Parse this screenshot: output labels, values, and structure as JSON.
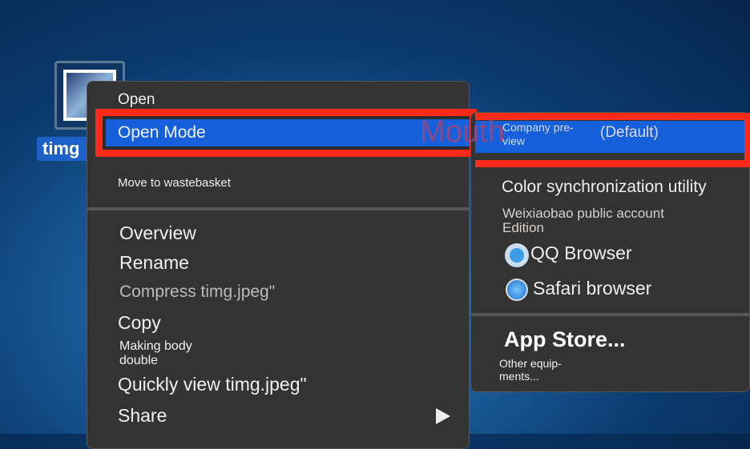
{
  "desktop": {
    "file_label": "timg"
  },
  "menu": {
    "items": [
      "Open",
      "Open Mode",
      "Move to wastebasket",
      "Overview",
      "Rename",
      "Compress timg.jpeg\"",
      "Copy",
      "Making body double",
      "Quickly view timg.jpeg\"",
      "Share"
    ]
  },
  "overlay_text": "Mouth",
  "submenu": {
    "default_app": "Company pre-view",
    "default_tag": "(Default)",
    "apps": [
      "Color synchronization utility",
      "Weixiaobao public account Edition",
      "QQ Browser",
      "Safari browser"
    ],
    "app_store": "App Store...",
    "other": "Other equip-ments..."
  },
  "colors": {
    "highlight": "#1660dc",
    "annotation": "#ff2a1a"
  }
}
